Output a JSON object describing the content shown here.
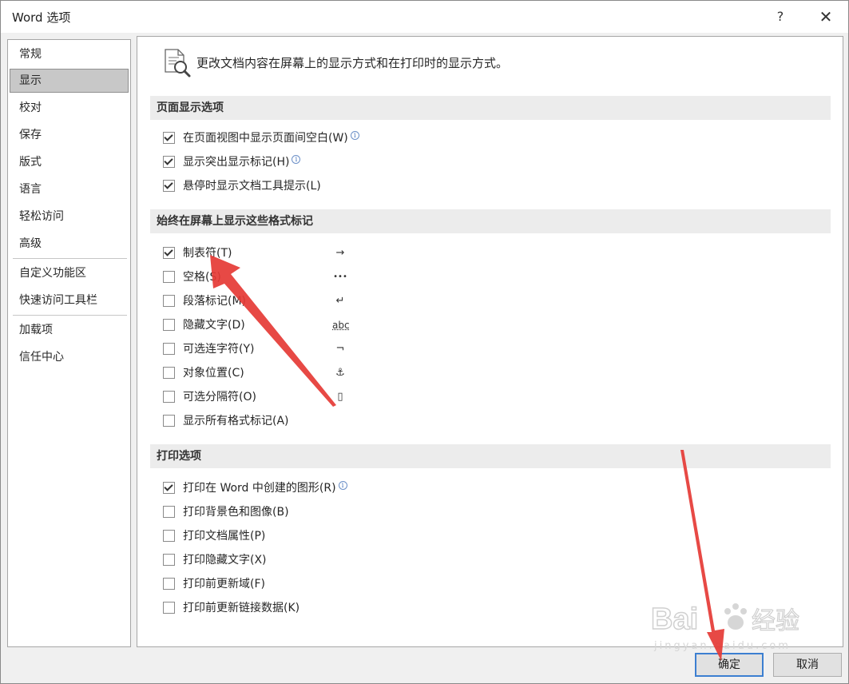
{
  "window": {
    "title": "Word 选项",
    "help": "?",
    "close": "✕"
  },
  "nav": {
    "items": [
      {
        "label": "常规"
      },
      {
        "label": "显示"
      },
      {
        "label": "校对"
      },
      {
        "label": "保存"
      },
      {
        "label": "版式"
      },
      {
        "label": "语言"
      },
      {
        "label": "轻松访问"
      },
      {
        "label": "高级"
      },
      {
        "label": "自定义功能区"
      },
      {
        "label": "快速访问工具栏"
      },
      {
        "label": "加载项"
      },
      {
        "label": "信任中心"
      }
    ],
    "selected": "显示"
  },
  "main": {
    "header": "更改文档内容在屏幕上的显示方式和在打印时的显示方式。",
    "sections": {
      "page_display": {
        "title": "页面显示选项",
        "options": [
          {
            "label": "在页面视图中显示页面间空白(W)",
            "checked": true,
            "info": "i"
          },
          {
            "label": "显示突出显示标记(H)",
            "checked": true,
            "info": "i"
          },
          {
            "label": "悬停时显示文档工具提示(L)",
            "checked": true
          }
        ]
      },
      "format_marks": {
        "title": "始终在屏幕上显示这些格式标记",
        "options": [
          {
            "label": "制表符(T)",
            "checked": true,
            "mark": "→"
          },
          {
            "label": "空格(S)",
            "checked": false,
            "mark": "•••"
          },
          {
            "label": "段落标记(M)",
            "checked": false,
            "mark": "↵"
          },
          {
            "label": "隐藏文字(D)",
            "checked": false,
            "mark": "abc"
          },
          {
            "label": "可选连字符(Y)",
            "checked": false,
            "mark": "¬"
          },
          {
            "label": "对象位置(C)",
            "checked": false,
            "mark": "⚓"
          },
          {
            "label": "可选分隔符(O)",
            "checked": false,
            "mark": "▯"
          },
          {
            "label": "显示所有格式标记(A)",
            "checked": false
          }
        ]
      },
      "print": {
        "title": "打印选项",
        "options": [
          {
            "label": "打印在 Word 中创建的图形(R)",
            "checked": true,
            "info": "i"
          },
          {
            "label": "打印背景色和图像(B)",
            "checked": false
          },
          {
            "label": "打印文档属性(P)",
            "checked": false
          },
          {
            "label": "打印隐藏文字(X)",
            "checked": false
          },
          {
            "label": "打印前更新域(F)",
            "checked": false
          },
          {
            "label": "打印前更新链接数据(K)",
            "checked": false
          }
        ]
      }
    }
  },
  "buttons": {
    "ok": "确定",
    "cancel": "取消"
  },
  "watermark": {
    "brand": "Bai",
    "brand2": "经验",
    "url": "jingyan.baidu.com"
  },
  "annotation_color": "#e53935"
}
